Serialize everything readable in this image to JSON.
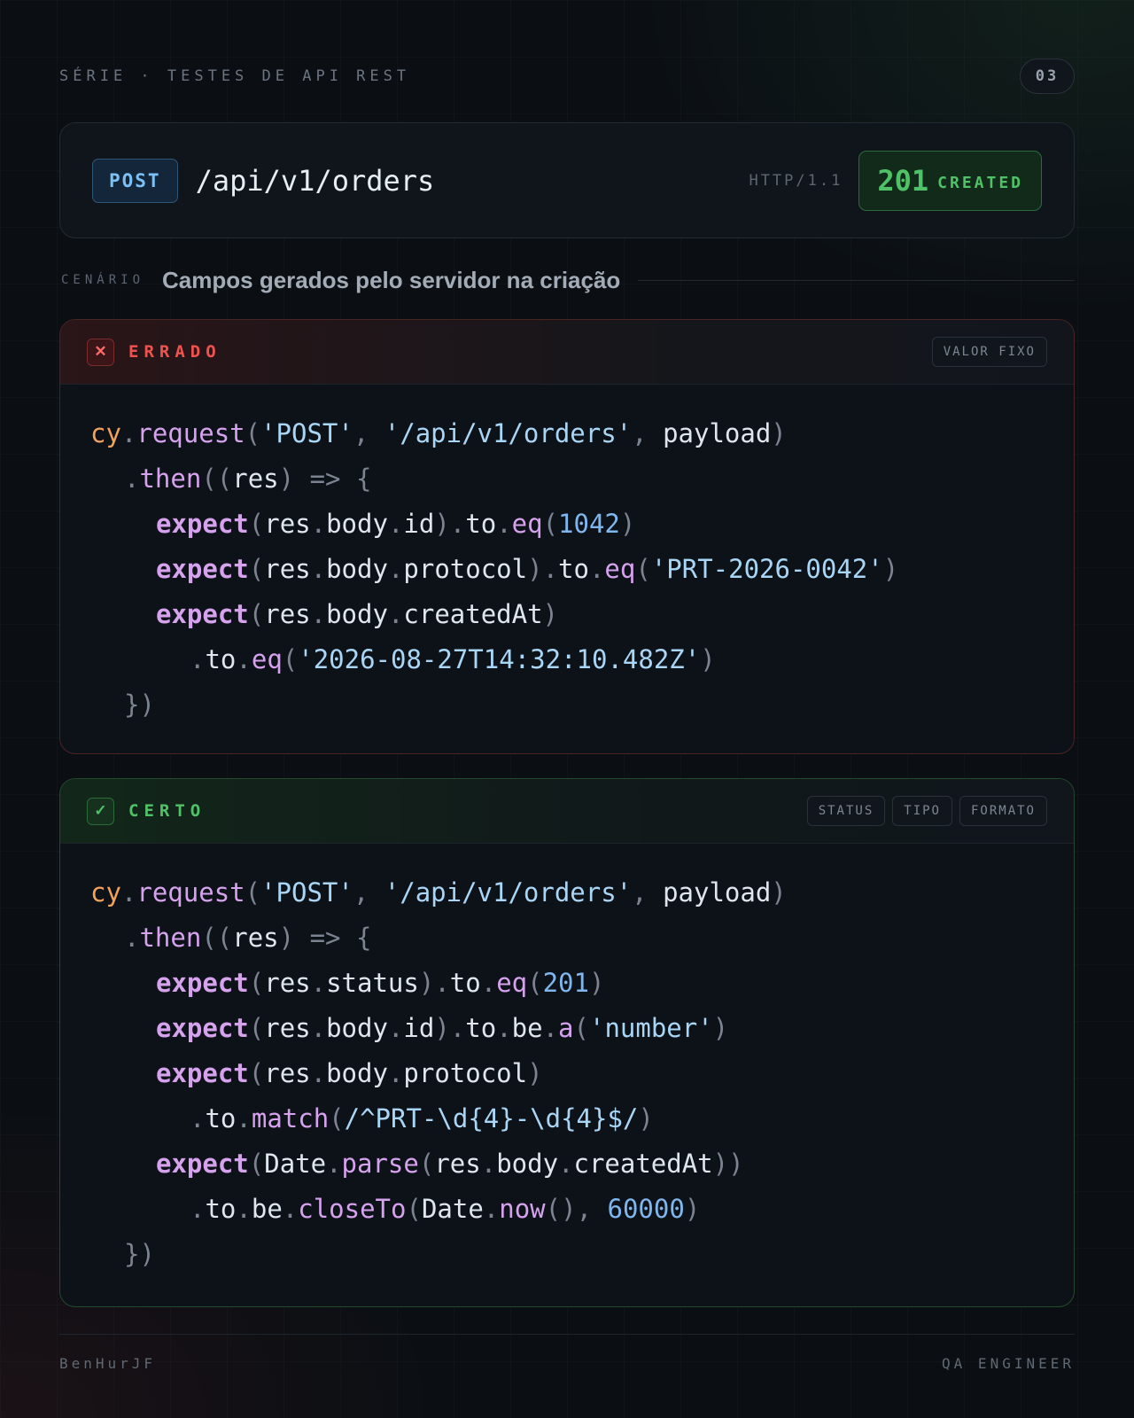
{
  "header": {
    "series": "SÉRIE · TESTES DE API REST",
    "page_number": "03"
  },
  "request": {
    "method": "POST",
    "path": "/api/v1/orders",
    "protocol": "HTTP/1.1",
    "status_code": "201",
    "status_text": "CREATED"
  },
  "scenario": {
    "label": "CENÁRIO",
    "text": "Campos gerados pelo servidor na criação"
  },
  "wrong": {
    "icon": "x-icon",
    "icon_glyph": "✕",
    "label": "ERRADO",
    "tags": [
      "VALOR FIXO"
    ],
    "code_lines": [
      "cy.request('POST', '/api/v1/orders', payload)",
      ".then((res) => {",
      "expect(res.body.id).to.eq(1042)",
      "expect(res.body.protocol).to.eq('PRT-2026-0042')",
      "expect(res.body.createdAt)",
      ".to.eq('2026-08-27T14:32:10.482Z')",
      "})"
    ]
  },
  "right": {
    "icon": "check-icon",
    "icon_glyph": "✓",
    "label": "CERTO",
    "tags": [
      "STATUS",
      "TIPO",
      "FORMATO"
    ],
    "code_lines": [
      "cy.request('POST', '/api/v1/orders', payload)",
      ".then((res) => {",
      "expect(res.status).to.eq(201)",
      "expect(res.body.id).to.be.a('number')",
      "expect(res.body.protocol)",
      ".to.match(/^PRT-\\d{4}-\\d{4}$/)",
      "expect(Date.parse(res.body.createdAt))",
      ".to.be.closeTo(Date.now(), 60000)",
      "})"
    ]
  },
  "footer": {
    "author": "BenHurJF",
    "role": "QA ENGINEER"
  },
  "colors": {
    "background": "#0b0f14",
    "error": "#f0534f",
    "success": "#4fc268",
    "method": "#7cc0f5",
    "string": "#a9d6f6",
    "number": "#7fb6ee",
    "function": "#d6a2ee",
    "object": "#f2a35a"
  }
}
